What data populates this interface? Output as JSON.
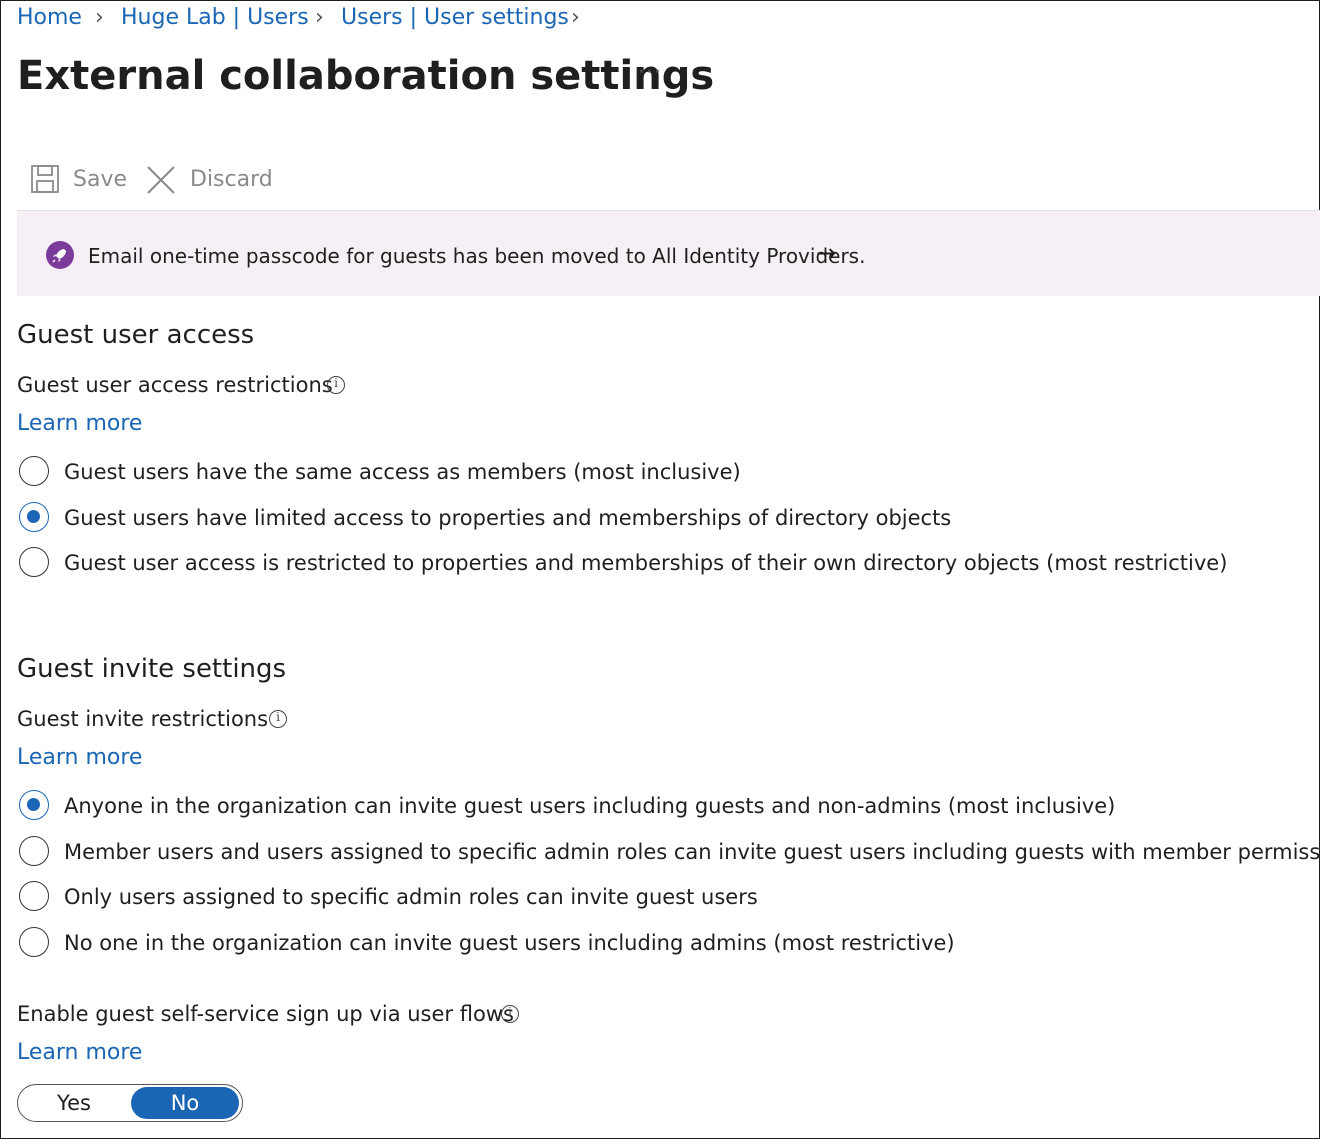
{
  "breadcrumb": {
    "items": [
      "Home",
      "Huge Lab | Users",
      "Users | User settings"
    ]
  },
  "page": {
    "title": "External collaboration settings",
    "more_label": "···"
  },
  "toolbar": {
    "save_label": "Save",
    "discard_label": "Discard"
  },
  "banner": {
    "text": "Email one-time passcode for guests has been moved to All Identity Providers.",
    "arrow": "→",
    "icon": "rocket-icon"
  },
  "guest_access": {
    "heading": "Guest user access",
    "label": "Guest user access restrictions",
    "learn_more": "Learn more",
    "options": [
      {
        "label": "Guest users have the same access as members (most inclusive)",
        "selected": false
      },
      {
        "label": "Guest users have limited access to properties and memberships of directory objects",
        "selected": true
      },
      {
        "label": "Guest user access is restricted to properties and memberships of their own directory objects (most restrictive)",
        "selected": false
      }
    ]
  },
  "guest_invite": {
    "heading": "Guest invite settings",
    "label": "Guest invite restrictions",
    "learn_more": "Learn more",
    "options": [
      {
        "label": "Anyone in the organization can invite guest users including guests and non-admins (most inclusive)",
        "selected": true
      },
      {
        "label": "Member users and users assigned to specific admin roles can invite guest users including guests with member permissions",
        "selected": false
      },
      {
        "label": "Only users assigned to specific admin roles can invite guest users",
        "selected": false
      },
      {
        "label": "No one in the organization can invite guest users including admins (most restrictive)",
        "selected": false
      }
    ]
  },
  "self_service": {
    "label": "Enable guest self-service sign up via user flows",
    "learn_more": "Learn more",
    "toggle": {
      "yes_label": "Yes",
      "no_label": "No",
      "selected": "No"
    }
  },
  "colors": {
    "accent": "#1a66b5",
    "banner_bg": "#f6f0f6",
    "banner_icon": "#7a3b9a",
    "disabled_text": "#8a8a8a"
  }
}
